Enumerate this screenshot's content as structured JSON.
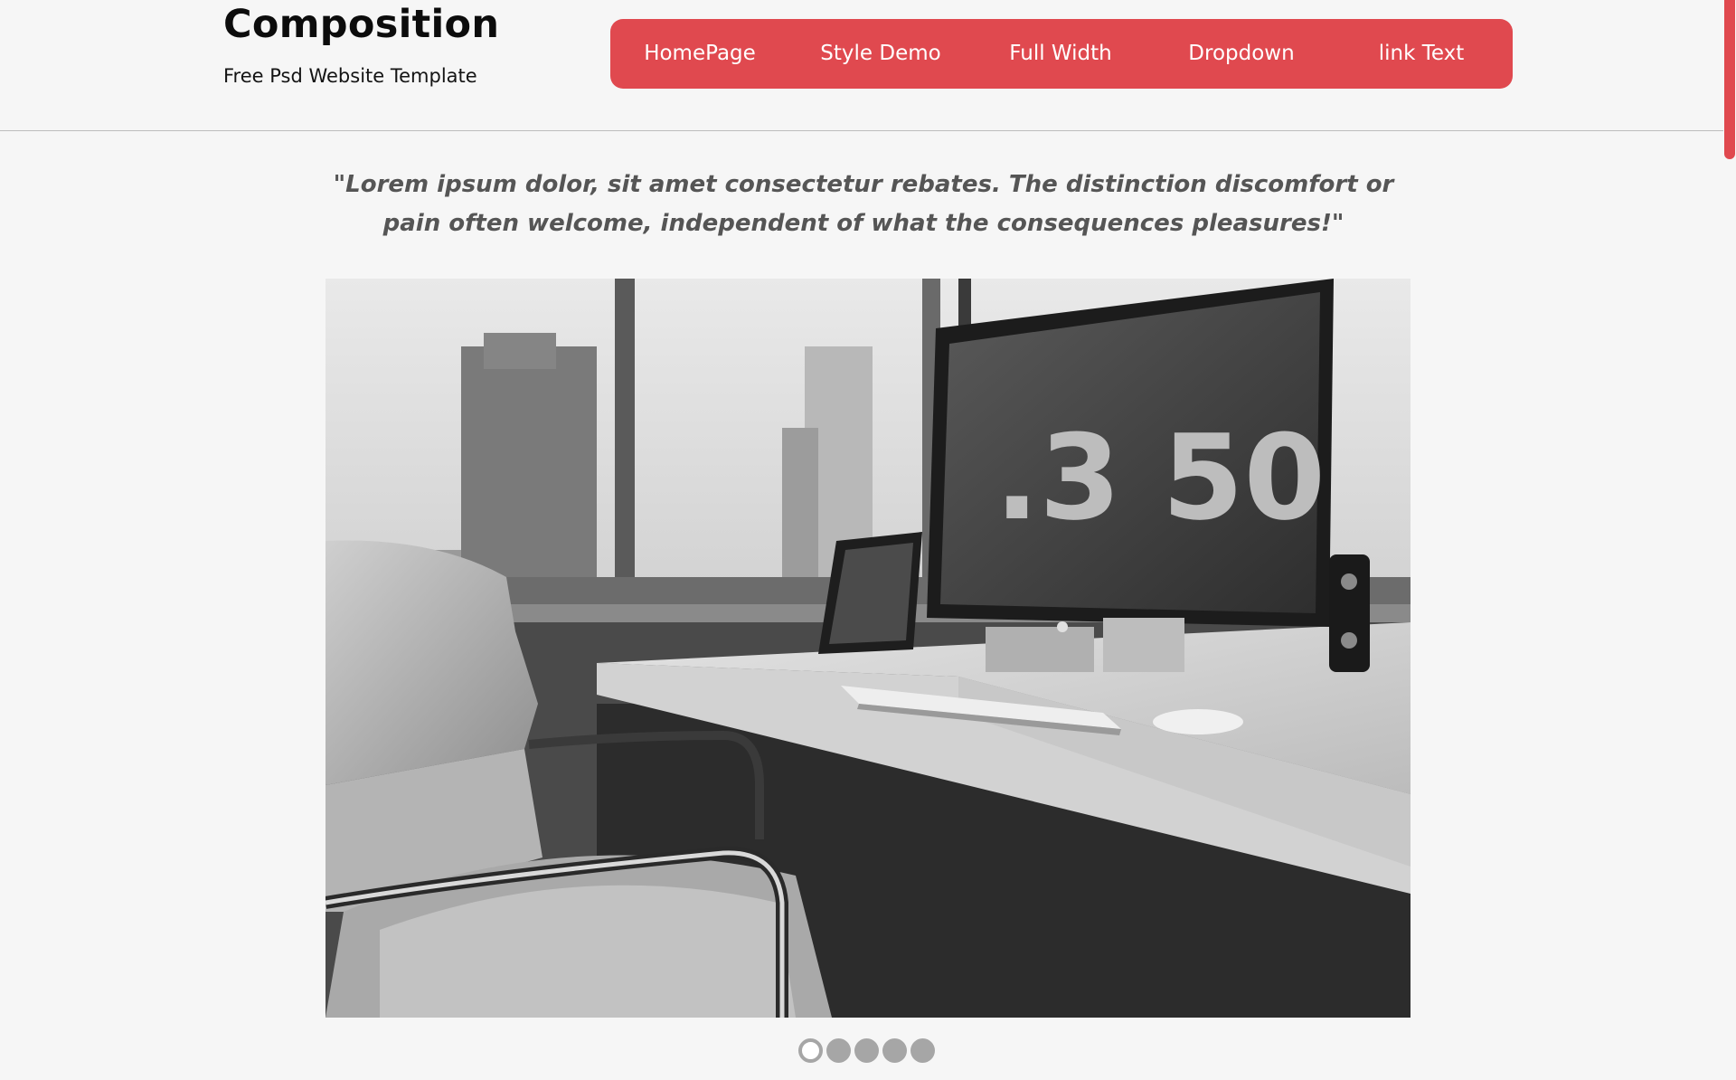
{
  "header": {
    "title": "Composition",
    "subtitle": "Free Psd Website Template"
  },
  "nav": {
    "items": [
      {
        "label": "HomePage"
      },
      {
        "label": "Style Demo"
      },
      {
        "label": "Full Width"
      },
      {
        "label": "Dropdown"
      },
      {
        "label": "link Text"
      }
    ]
  },
  "quote": {
    "text": "\"Lorem ipsum dolor, sit amet consectetur rebates. The distinction discomfort or pain often welcome, independent of what the consequences pleasures!\""
  },
  "hero": {
    "clock_text": ".3 50"
  },
  "slider": {
    "slide_count": 5,
    "active_index": 0
  },
  "colors": {
    "accent": "#e0494f",
    "background": "#f6f6f6",
    "quote_text": "#555555"
  }
}
